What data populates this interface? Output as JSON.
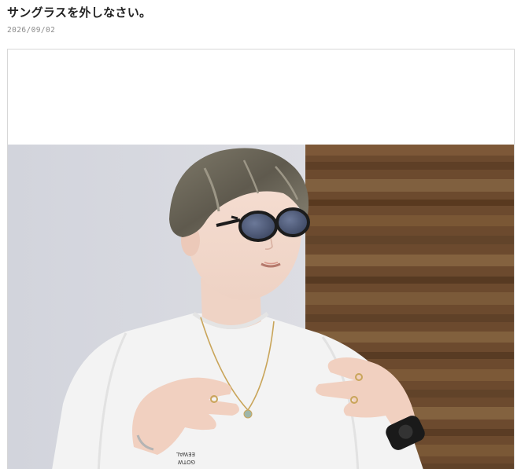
{
  "post": {
    "title": "サングラスを外しなさい。",
    "date": "2026/09/02"
  },
  "photo": {
    "subject": "person-wearing-sunglasses-photo",
    "shirt_print_line1": "EEWAL",
    "shirt_print_line2": "GOTW"
  },
  "colors": {
    "title_text": "#222222",
    "date_text": "#8a8a8a",
    "frame_border": "#d7d7d7",
    "wall": "#d6d8df",
    "wood": "#6f4a2c",
    "shirt": "#f2f2f2",
    "hair": "#6d6658",
    "lens": "#4e5a7a"
  }
}
